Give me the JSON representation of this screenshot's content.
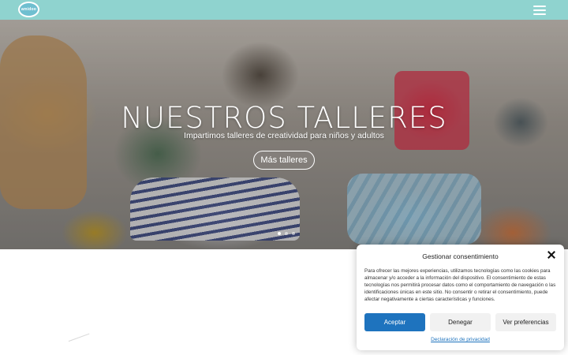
{
  "header": {
    "logo_text": "amidoo",
    "menu_icon": "hamburger-menu-icon",
    "background_color": "#8fd3cf"
  },
  "hero": {
    "title": "NUESTROS TALLERES",
    "subtitle": "Impartimos talleres de creatividad para niños y adultos",
    "button_label": "Más talleres",
    "slides_total": 3,
    "active_slide": 1
  },
  "cookie_dialog": {
    "title": "Gestionar consentimiento",
    "body": "Para ofrecer las mejores experiencias, utilizamos tecnologías como las cookies para almacenar y/o acceder a la información del dispositivo. El consentimiento de estas tecnologías nos permitirá procesar datos como el comportamiento de navegación o las identificaciones únicas en este sitio. No consentir o retirar el consentimiento, puede afectar negativamente a ciertas características y funciones.",
    "accept_label": "Aceptar",
    "deny_label": "Denegar",
    "preferences_label": "Ver preferencias",
    "privacy_link": "Declaración de privacidad",
    "accent_color": "#1e73be"
  }
}
